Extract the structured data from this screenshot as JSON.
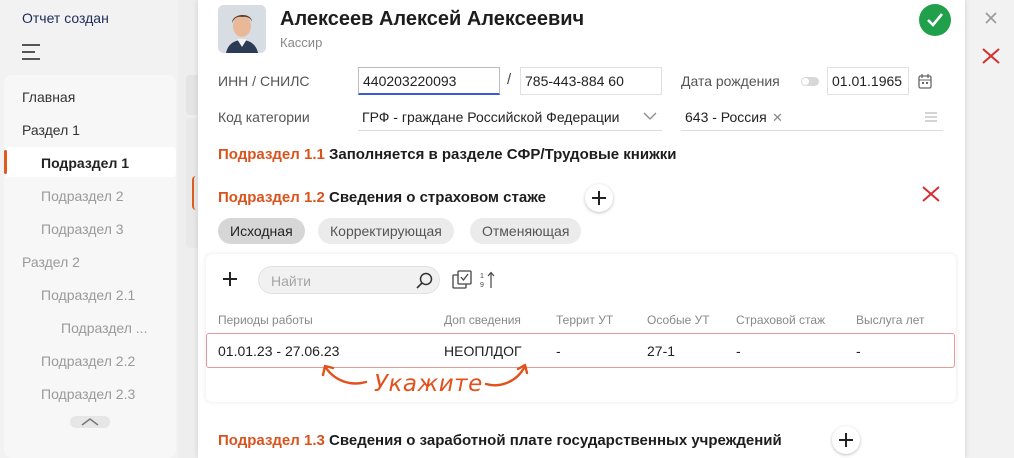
{
  "sidebar": {
    "status": "Отчет создан",
    "items": [
      {
        "label": "Главная"
      },
      {
        "label": "Раздел 1"
      },
      {
        "label": "Подраздел 1"
      },
      {
        "label": "Подраздел 2"
      },
      {
        "label": "Подраздел 3"
      },
      {
        "label": "Раздел 2"
      },
      {
        "label": "Подраздел 2.1"
      },
      {
        "label": "Подраздел ..."
      },
      {
        "label": "Подраздел 2.2"
      },
      {
        "label": "Подраздел 2.3"
      }
    ]
  },
  "person": {
    "name": "Алексеев Алексей Алексеевич",
    "role": "Кассир"
  },
  "form": {
    "inn_label": "ИНН / СНИЛС",
    "inn_value": "440203220093",
    "snils_value": "785-443-884 60",
    "birth_label": "Дата рождения",
    "birth_value": "01.01.1965",
    "category_label": "Код категории",
    "category_value": "ГРФ - граждане Российской Федерации",
    "country_value": "643 - Россия"
  },
  "sections": {
    "s11_num": "Подраздел 1.1",
    "s11_title": "Заполняется в разделе СФР/Трудовые книжки",
    "s12_num": "Подраздел 1.2",
    "s12_title": "Сведения о страховом стаже",
    "s13_num": "Подраздел 1.3",
    "s13_title": "Сведения о заработной плате государственных учреждений"
  },
  "tabs": [
    {
      "label": "Исходная",
      "selected": true
    },
    {
      "label": "Корректирующая",
      "selected": false
    },
    {
      "label": "Отменяющая",
      "selected": false
    }
  ],
  "table": {
    "search_placeholder": "Найти",
    "columns": [
      "Периоды работы",
      "Доп сведения",
      "Террит УТ",
      "Особые УТ",
      "Страховой стаж",
      "Выслуга лет"
    ],
    "rows": [
      [
        "01.01.23 - 27.06.23",
        "НЕОПЛДОГ",
        "-",
        "27-1",
        "-",
        "-"
      ]
    ]
  },
  "hint": "Укажите",
  "colors": {
    "accent": "#d9531e",
    "success": "#21a04b",
    "danger": "#d32f2f",
    "focus": "#3a5bd9"
  },
  "icons": [
    "hamburger-icon",
    "check-icon",
    "calendar-icon",
    "chevron-down-icon",
    "clear-icon",
    "menu-lines-icon",
    "plus-icon",
    "delete-x-icon",
    "search-icon",
    "checklist-icon",
    "sort-icon",
    "close-icon",
    "chevron-up-icon"
  ]
}
